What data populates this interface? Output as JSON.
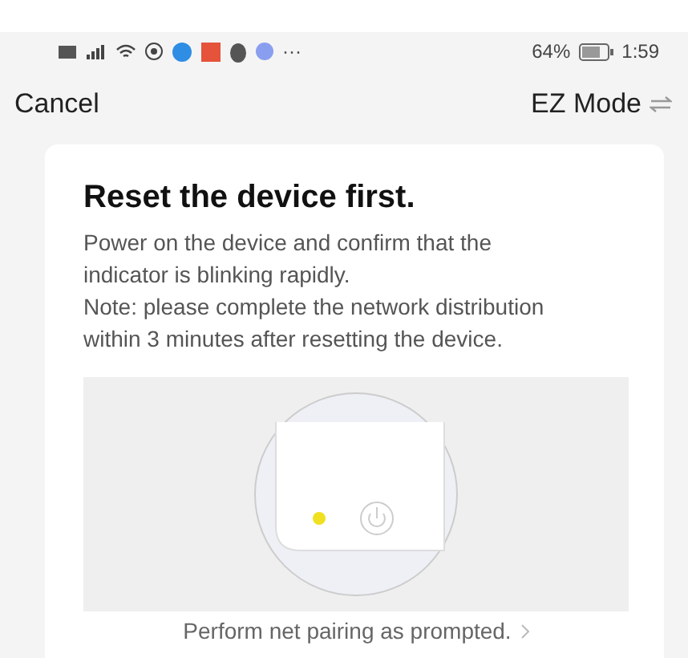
{
  "status_bar": {
    "battery_percent": "64%",
    "time": "1:59",
    "overflow": "···"
  },
  "nav": {
    "cancel": "Cancel",
    "mode": "EZ Mode"
  },
  "card": {
    "title": "Reset the device first.",
    "body": [
      "Power on the device and confirm that the indicator is blinking rapidly.",
      "Note: please complete the network distribution within 3 minutes after resetting the device."
    ],
    "link": "Perform net pairing as prompted."
  }
}
